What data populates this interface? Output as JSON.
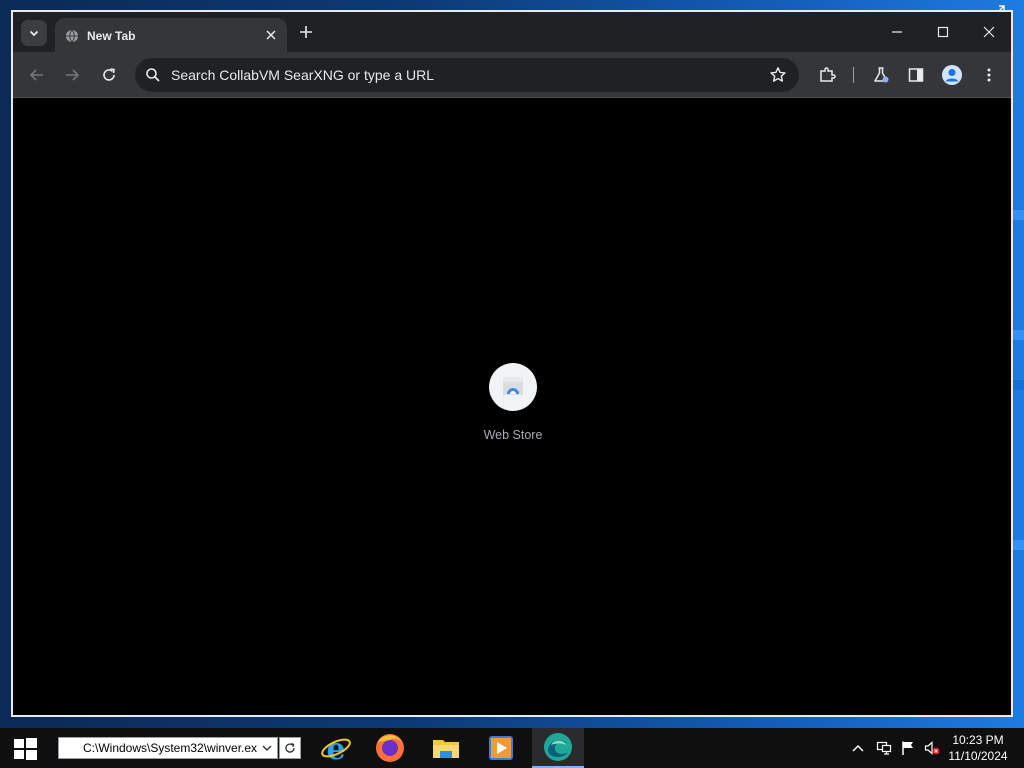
{
  "browser": {
    "tab": {
      "title": "New Tab"
    },
    "omnibox": {
      "placeholder": "Search CollabVM SearXNG or type a URL"
    },
    "shortcuts": [
      {
        "label": "Web Store",
        "icon": "web-store-icon"
      }
    ]
  },
  "taskbar": {
    "run_value": "C:\\Windows\\System32\\winver.ex",
    "clock": {
      "time": "10:23 PM",
      "date": "11/10/2024"
    },
    "apps": [
      "internet-explorer-icon",
      "firefox-icon",
      "file-explorer-icon",
      "media-player-icon",
      "edge-icon"
    ]
  },
  "colors": {
    "tabstrip": "#202124",
    "toolbar": "#35363a",
    "content": "#000000",
    "taskbar": "#0f0f10",
    "accent": "#8ab4f8"
  }
}
